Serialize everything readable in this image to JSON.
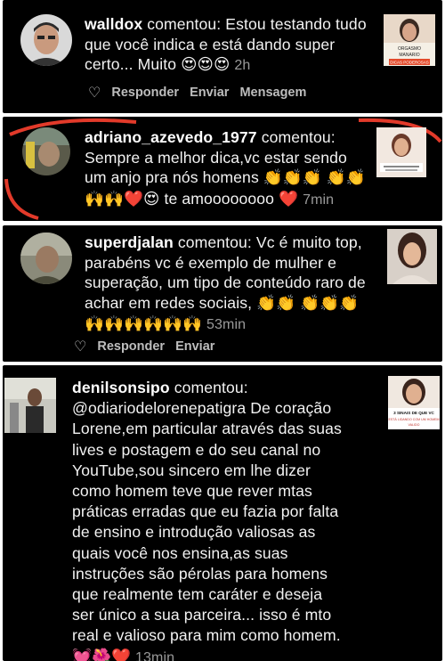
{
  "comments": [
    {
      "username": "walldox",
      "verb": "comentou:",
      "text": "Estou testando tudo que você indica e está dando super certo... Muito",
      "emojis": "😍😍😍",
      "time": "2h",
      "thumb_text_1": "ORGASMO",
      "thumb_text_2": "MANARIO",
      "thumb_text_3": "DICAS PODEROSAS",
      "actions": {
        "reply": "Responder",
        "send": "Enviar",
        "message": "Mensagem"
      }
    },
    {
      "username": "adriano_azevedo_1977",
      "verb": "comentou:",
      "text": "Sempre a melhor dica,vc estar sendo um anjo pra nós homens",
      "emojis_line1": "👏👏👏",
      "emojis_line2": "👏👏🙌🙌❤️😍",
      "text_end": "te amoooooooo",
      "emojis_line3": "❤️",
      "time": "7min"
    },
    {
      "username": "superdjalan",
      "verb": "comentou:",
      "text": "Vc é muito top, parabéns vc é exemplo de mulher e superação, um tipo de conteúdo raro de achar em redes sociais,",
      "emojis_line1": "👏👏",
      "emojis_line2": "👏👏👏🙌🙌🙌🙌🙌🙌",
      "time": "53min",
      "actions": {
        "reply": "Responder",
        "send": "Enviar"
      }
    },
    {
      "username": "denilsonsipo",
      "verb": "comentou:",
      "lines": [
        "@odiariodelorenepatigra De coração",
        "Lorene,em particular através das suas",
        "lives e postagem e do seu canal no",
        "YouTube,sou sincero em lhe dizer",
        "como homem teve que rever mtas",
        "práticas erradas que eu fazia por falta",
        "de ensino e introdução valiosas as",
        "quais você nos ensina,as suas",
        "instruções são pérolas para homens",
        "que realmente tem caráter e deseja",
        "ser único a sua parceira... isso é mto",
        "real e valioso para mim como homem."
      ],
      "emojis": "💓🌺❤️",
      "time": "13min",
      "thumb_text_1": "3 SINAIS DE QUE VC",
      "thumb_text_2": "ESTÁ LIDANDO COM UM HOMEM",
      "thumb_text_3": "VALIDO"
    }
  ]
}
